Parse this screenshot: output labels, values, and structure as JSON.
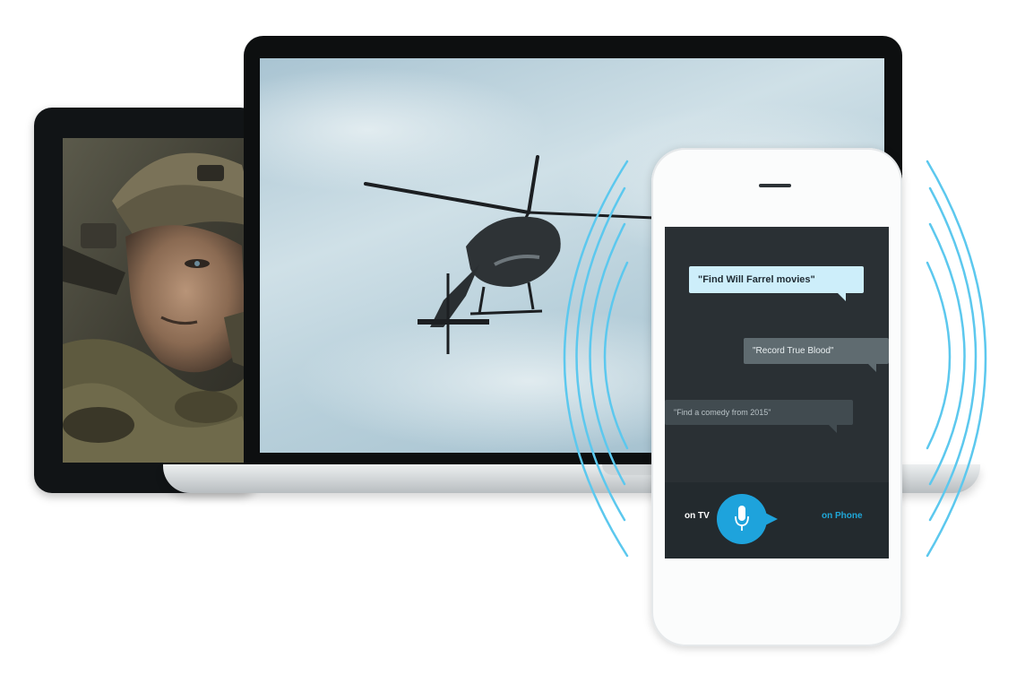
{
  "phone": {
    "bubbles": [
      {
        "text": "\"Find Will Farrel movies\""
      },
      {
        "text": "\"Record True Blood\""
      },
      {
        "text": "\"Find a comedy from 2015\""
      }
    ],
    "bar": {
      "left_label": "on TV",
      "right_label": "on Phone"
    },
    "mic": {
      "icon": "microphone-icon"
    }
  },
  "colors": {
    "accent": "#1EA3DC",
    "ring": "#5CC8EE",
    "phone_screen": "#2A3034",
    "bubble_highlight": "#CDEEFA"
  },
  "devices": {
    "tablet_content": "soldier-photo",
    "laptop_content": "helicopter-photo"
  }
}
